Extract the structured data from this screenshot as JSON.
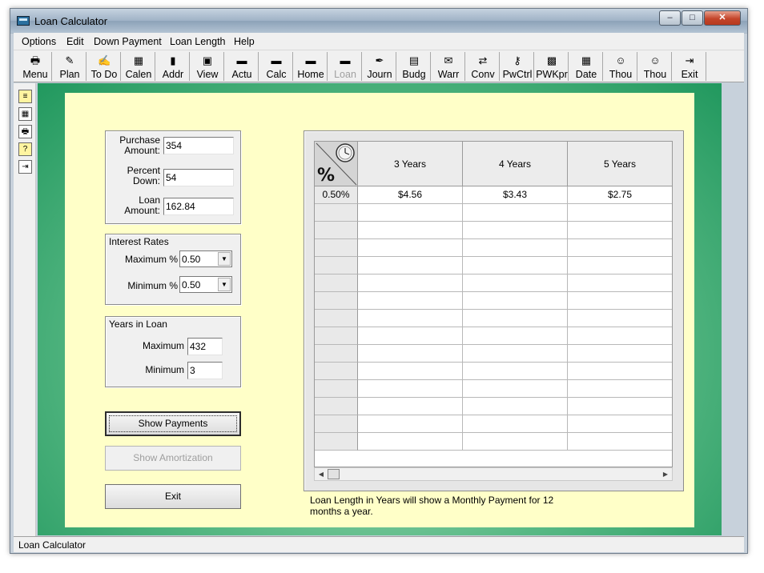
{
  "window": {
    "title": "Loan Calculator",
    "buttons": {
      "minimize": "–",
      "maximize": "□",
      "close": "✕"
    }
  },
  "menu": [
    "Options",
    "Edit",
    "Down Payment",
    "Loan Length",
    "Help"
  ],
  "toolbar": [
    {
      "label": "Menu",
      "icon": "printer-icon",
      "glyph": "🖶",
      "enabled": true
    },
    {
      "label": "Plan",
      "icon": "plan-icon",
      "glyph": "✎",
      "enabled": true
    },
    {
      "label": "To Do",
      "icon": "todo-icon",
      "glyph": "✍",
      "enabled": true
    },
    {
      "label": "Calen",
      "icon": "calendar-icon",
      "glyph": "▦",
      "enabled": true
    },
    {
      "label": "Addr",
      "icon": "address-book-icon",
      "glyph": "▮",
      "enabled": true
    },
    {
      "label": "View",
      "icon": "view-icon",
      "glyph": "▣",
      "enabled": true
    },
    {
      "label": "Actu",
      "icon": "actuarial-icon",
      "glyph": "▬",
      "enabled": true
    },
    {
      "label": "Calc",
      "icon": "calculator-icon",
      "glyph": "▬",
      "enabled": true
    },
    {
      "label": "Home",
      "icon": "home-icon",
      "glyph": "▬",
      "enabled": true
    },
    {
      "label": "Loan",
      "icon": "loan-icon",
      "glyph": "▬",
      "enabled": false
    },
    {
      "label": "Journ",
      "icon": "journal-icon",
      "glyph": "✒",
      "enabled": true
    },
    {
      "label": "Budg",
      "icon": "budget-icon",
      "glyph": "▤",
      "enabled": true
    },
    {
      "label": "Warr",
      "icon": "warranty-icon",
      "glyph": "✉",
      "enabled": true
    },
    {
      "label": "Conv",
      "icon": "convert-icon",
      "glyph": "⇄",
      "enabled": true
    },
    {
      "label": "PwCtrl",
      "icon": "password-control-icon",
      "glyph": "⚷",
      "enabled": true
    },
    {
      "label": "PWKpr",
      "icon": "password-keeper-icon",
      "glyph": "▩",
      "enabled": true
    },
    {
      "label": "Date",
      "icon": "date-icon",
      "glyph": "▦",
      "enabled": true
    },
    {
      "label": "Thou",
      "icon": "smiley-icon",
      "glyph": "☺",
      "enabled": true
    },
    {
      "label": "Thou",
      "icon": "smiley-icon",
      "glyph": "☺",
      "enabled": true
    },
    {
      "label": "Exit",
      "icon": "exit-icon",
      "glyph": "⇥",
      "enabled": true
    }
  ],
  "sidebar_icons": [
    "note-icon",
    "calculator-icon",
    "printer-icon",
    "help-icon",
    "exit-icon"
  ],
  "form": {
    "purchase_label": "Purchase Amount:",
    "purchase_value": "354",
    "percent_label": "Percent Down:",
    "percent_value": "54",
    "loan_label": "Loan Amount:",
    "loan_value": "162.84",
    "interest_title": "Interest Rates",
    "max_rate_label": "Maximum %",
    "max_rate_value": "0.50",
    "min_rate_label": "Minimum %",
    "min_rate_value": "0.50",
    "years_title": "Years in Loan",
    "max_years_label": "Maximum",
    "max_years_value": "432",
    "min_years_label": "Minimum",
    "min_years_value": "3"
  },
  "buttons": {
    "show_payments": "Show Payments",
    "show_amortization": "Show Amortization",
    "exit": "Exit"
  },
  "grid": {
    "columns": [
      "3 Years",
      "4 Years",
      "5 Years"
    ],
    "rows": [
      {
        "rate": "0.50%",
        "values": [
          "$4.56",
          "$3.43",
          "$2.75"
        ]
      },
      {
        "rate": "",
        "values": [
          "",
          "",
          ""
        ]
      },
      {
        "rate": "",
        "values": [
          "",
          "",
          ""
        ]
      },
      {
        "rate": "",
        "values": [
          "",
          "",
          ""
        ]
      },
      {
        "rate": "",
        "values": [
          "",
          "",
          ""
        ]
      },
      {
        "rate": "",
        "values": [
          "",
          "",
          ""
        ]
      },
      {
        "rate": "",
        "values": [
          "",
          "",
          ""
        ]
      },
      {
        "rate": "",
        "values": [
          "",
          "",
          ""
        ]
      },
      {
        "rate": "",
        "values": [
          "",
          "",
          ""
        ]
      },
      {
        "rate": "",
        "values": [
          "",
          "",
          ""
        ]
      },
      {
        "rate": "",
        "values": [
          "",
          "",
          ""
        ]
      },
      {
        "rate": "",
        "values": [
          "",
          "",
          ""
        ]
      },
      {
        "rate": "",
        "values": [
          "",
          "",
          ""
        ]
      },
      {
        "rate": "",
        "values": [
          "",
          "",
          ""
        ]
      },
      {
        "rate": "",
        "values": [
          "",
          "",
          ""
        ]
      }
    ]
  },
  "note": "Loan Length in Years will show a Monthly Payment for 12 months a year.",
  "status": "Loan Calculator"
}
